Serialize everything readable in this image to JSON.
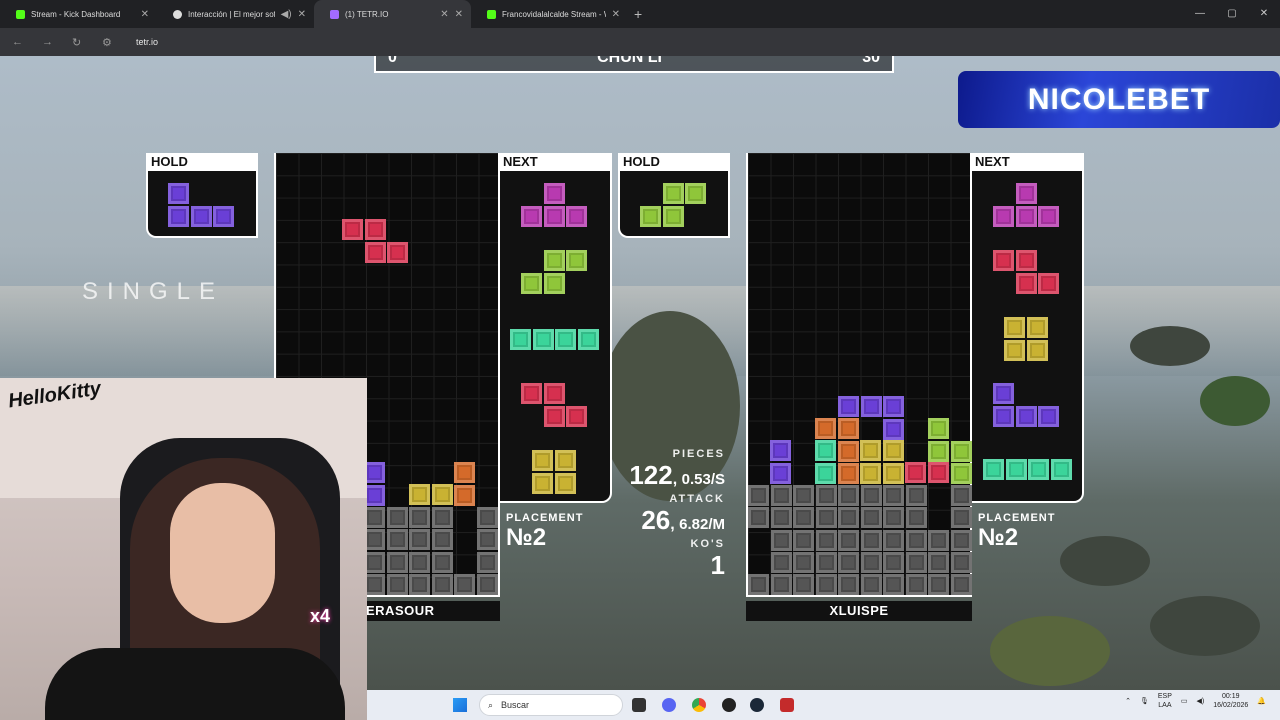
{
  "browser": {
    "tabs": [
      {
        "title": "Stream - Kick Dashboard",
        "color": "#53fc18"
      },
      {
        "title": "Interacción | El mejor softw",
        "color": "#dddddd"
      },
      {
        "title": "(1) TETR.IO",
        "color": "#a36bff"
      },
      {
        "title": "Francovidalalcalde Stream - Wa",
        "color": "#53fc18"
      }
    ],
    "url": "tetr.io"
  },
  "scorebar": {
    "left_score": "0",
    "title": "CHUN LI",
    "right_score": "30"
  },
  "sponsor": "NICOLEBET",
  "mode_text": "SINGLE",
  "player_left": {
    "hold_label": "HOLD",
    "next_label": "NEXT",
    "name": "ERASOUR",
    "placement_label": "PLACEMENT",
    "placement": "№2"
  },
  "player_right": {
    "hold_label": "HOLD",
    "next_label": "NEXT",
    "name": "XLUISPE",
    "placement_label": "PLACEMENT",
    "placement": "№2"
  },
  "stats": {
    "pieces_label": "PIECES",
    "pieces": "122",
    "pieces_rate": "0.53/S",
    "attack_label": "ATTACK",
    "attack": "26",
    "attack_rate": "6.82/M",
    "kos_label": "KO'S",
    "kos": "1"
  },
  "webcam": {
    "overlay_text": "HelloKitty",
    "multiplier": "x4"
  },
  "taskbar": {
    "search_placeholder": "Buscar",
    "lang_top": "ESP",
    "lang_bottom": "LAA",
    "time": "00:19",
    "date": "16/02/2026"
  },
  "colors": {
    "purple": "#6a3fd6",
    "red": "#d6304f",
    "green": "#8fc63a",
    "magenta": "#b83ab0",
    "cyan": "#3bd49a",
    "yellow": "#c9b232",
    "orange": "#d46a2a",
    "garbage": "#555555"
  }
}
